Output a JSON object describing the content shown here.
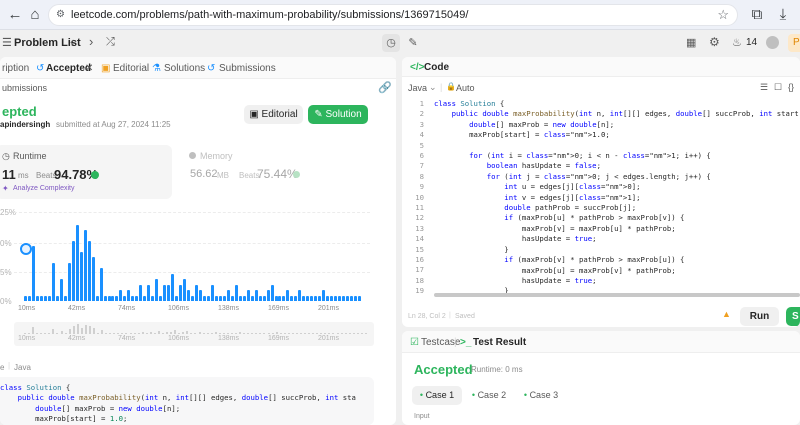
{
  "browser": {
    "url": "leetcode.com/problems/path-with-maximum-probability/submissions/1369715049/"
  },
  "toolbar": {
    "problem_list": "Problem List",
    "streak": "14",
    "premium": "P"
  },
  "left_tabs": [
    {
      "label": "ription"
    },
    {
      "label": "Accepted"
    },
    {
      "label": "Editorial"
    },
    {
      "label": "Solutions"
    },
    {
      "label": "Submissions"
    }
  ],
  "submission": {
    "breadcrumb": "ubmissions",
    "status": "epted",
    "user": "apindersingh",
    "submitted_at": "submitted at Aug 27, 2024 11:25",
    "editorial_btn": "Editorial",
    "solution_btn": "Solution",
    "runtime_label": "Runtime",
    "runtime_value": "11",
    "runtime_unit": "ms",
    "beats_label": "Beats",
    "runtime_beats": "94.78%",
    "analyze": "Analyze Complexity",
    "memory_label": "Memory",
    "memory_value": "56.62",
    "memory_unit": "MB",
    "memory_beats": "75.44%",
    "lang_prefix": "e",
    "lang": "Java"
  },
  "chart_data": {
    "type": "bar",
    "ylabels": [
      "25%",
      "0%",
      "5%",
      "0%"
    ],
    "xlabels": [
      "10ms",
      "42ms",
      "74ms",
      "106ms",
      "138ms",
      "169ms",
      "201ms"
    ],
    "values": [
      1,
      1,
      10,
      1,
      1,
      1,
      1,
      7,
      1,
      4,
      1,
      7,
      11,
      14,
      9,
      13,
      11,
      8,
      1,
      6,
      1,
      1,
      1,
      1,
      2,
      1,
      2,
      1,
      1,
      3,
      1,
      3,
      1,
      4,
      1,
      3,
      3,
      5,
      1,
      3,
      4,
      2,
      1,
      3,
      2,
      1,
      1,
      3,
      1,
      1,
      1,
      2,
      1,
      3,
      1,
      1,
      2,
      1,
      2,
      1,
      1,
      2,
      3,
      1,
      1,
      1,
      2,
      1,
      1,
      2,
      1,
      1,
      1,
      1,
      1,
      2,
      1,
      1,
      1,
      1,
      1,
      1,
      1,
      1,
      1
    ],
    "ylim": [
      0,
      25
    ]
  },
  "mini_code": [
    "class Solution {",
    "    public double maxProbability(int n, int[][] edges, double[] succProb, int sta",
    "        double[] maxProb = new double[n];",
    "        maxProb[start] = 1.0;"
  ],
  "code_panel": {
    "title": "Code",
    "lang": "Java",
    "auto": "Auto",
    "lines": [
      "class Solution {",
      "    public double maxProbability(int n, int[][] edges, double[] succProb, int start, int e",
      "        double[] maxProb = new double[n];",
      "        maxProb[start] = 1.0;",
      "",
      "        for (int i = 0; i < n - 1; i++) {",
      "            boolean hasUpdate = false;",
      "            for (int j = 0; j < edges.length; j++) {",
      "                int u = edges[j][0];",
      "                int v = edges[j][1];",
      "                double pathProb = succProb[j];",
      "                if (maxProb[u] * pathProb > maxProb[v]) {",
      "                    maxProb[v] = maxProb[u] * pathProb;",
      "                    hasUpdate = true;",
      "                }",
      "                if (maxProb[v] * pathProb > maxProb[u]) {",
      "                    maxProb[u] = maxProb[v] * pathProb;",
      "                    hasUpdate = true;",
      "                }"
    ],
    "line_numbers": [
      "1",
      "2",
      "3",
      "4",
      "5",
      "6",
      "7",
      "8",
      "9",
      "10",
      "11",
      "12",
      "13",
      "14",
      "15",
      "16",
      "17",
      "18",
      "19"
    ],
    "status": "Ln 28, Col 2",
    "saved": "Saved",
    "run": "Run",
    "submit": "S"
  },
  "result_panel": {
    "testcase_tab": "Testcase",
    "result_tab": "Test Result",
    "accepted": "Accepted",
    "runtime": "Runtime: 0 ms",
    "cases": [
      "Case 1",
      "Case 2",
      "Case 3"
    ],
    "input_label": "Input"
  }
}
